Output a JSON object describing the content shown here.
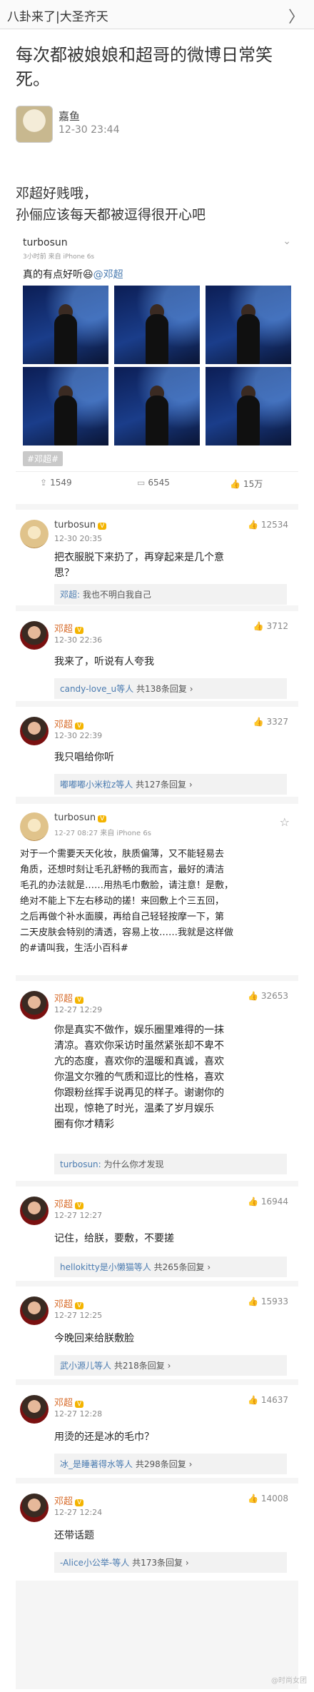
{
  "topbar": {
    "title": "八卦来了|大圣齐天",
    "chevron": "〉"
  },
  "article": {
    "title": "每次都被娘娘和超哥的微博日常笑死。",
    "author": "嘉鱼",
    "time": "12-30 23:44",
    "intro": [
      "邓超好贱哦，",
      "孙俪应该每天都被逗得很开心吧"
    ]
  },
  "post1": {
    "name": "turbosun",
    "meta": "3小时前 来自 iPhone 6s",
    "text": "真的有点好听",
    "mention": "@邓超",
    "tag": "#邓超#",
    "share": "1549",
    "comment": "6545",
    "like": "15万"
  },
  "comments": [
    {
      "name": "turbosun",
      "time": "12-30 20:35",
      "likes": "12534",
      "text": [
        "把衣服脱下来扔了，再穿起来是几个意",
        "思？"
      ],
      "sub_who": "邓超:",
      "sub_text": "我也不明白我自己"
    },
    {
      "name": "邓超",
      "time": "12-30 22:36",
      "likes": "3712",
      "text": [
        "我来了，听说有人夸我"
      ],
      "sub_who": "candy-love_u等人",
      "sub_text": "共138条回复 ›"
    },
    {
      "name": "邓超",
      "time": "12-30 22:39",
      "likes": "3327",
      "text": [
        "我只唱给你听"
      ],
      "sub_who": "嘟嘟嘟小米粒z等人",
      "sub_text": "共127条回复 ›"
    }
  ],
  "post2": {
    "name": "turbosun",
    "meta": "12-27 08:27 来自 iPhone 6s",
    "text": [
      "对于一个需要天天化妆，肤质偏薄，又不能轻易去",
      "角质，还想时刻让毛孔舒畅的我而言，最好的清洁",
      "毛孔的办法就是……用热毛巾敷脸，请注意！是敷，",
      "绝对不能上下左右移动的搓！来回敷上个三五回，",
      "之后再做个补水面膜，再给自己轻轻按摩一下，第",
      "二天皮肤会特别的清透，容易上妆……我就是这样做",
      "的#请叫我，生活小百科#"
    ]
  },
  "comments2": [
    {
      "name": "邓超",
      "time": "12-27 12:29",
      "likes": "32653",
      "text": [
        "你是真实不做作，娱乐圈里难得的一抹",
        "清凉。喜欢你采访时虽然紧张却不卑不",
        "亢的态度，喜欢你的温暖和真诚，喜欢",
        "你温文尔雅的气质和逗比的性格，喜欢",
        "你跟粉丝挥手说再见的样子。谢谢你的",
        "出现，惊艳了时光，温柔了岁月娱乐",
        "圈有你才精彩"
      ],
      "sub_who": "turbosun:",
      "sub_text": "为什么你才发现"
    },
    {
      "name": "邓超",
      "time": "12-27 12:27",
      "likes": "16944",
      "text": [
        "记住，给朕，要敷，不要搓"
      ],
      "sub_who": "hellokitty是小懒猫等人",
      "sub_text": "共265条回复 ›"
    },
    {
      "name": "邓超",
      "time": "12-27 12:25",
      "likes": "15933",
      "text": [
        "今晚回来给朕敷脸"
      ],
      "sub_who": "武小源儿等人",
      "sub_text": "共218条回复 ›"
    },
    {
      "name": "邓超",
      "time": "12-27 12:28",
      "likes": "14637",
      "text": [
        "用烫的还是冰的毛巾？"
      ],
      "sub_who": "冰_是睡著得水等人",
      "sub_text": "共298条回复 ›"
    },
    {
      "name": "邓超",
      "time": "12-27 12:24",
      "likes": "14008",
      "text": [
        "还带话题"
      ],
      "sub_who": "-Alice小公举-等人",
      "sub_text": "共173条回复 ›"
    }
  ],
  "watermark": "@时尚女团",
  "icons": {
    "share": "share-icon",
    "comment": "comment-icon",
    "like": "thumb-up-icon",
    "star": "star-icon"
  }
}
